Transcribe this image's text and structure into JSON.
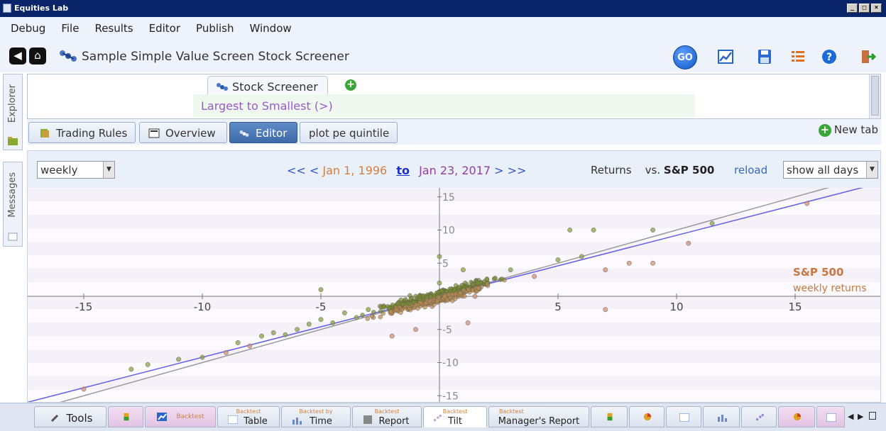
{
  "window": {
    "title": "Equities Lab"
  },
  "menu": [
    "Debug",
    "File",
    "Results",
    "Editor",
    "Publish",
    "Window"
  ],
  "toolbar": {
    "doc_title": "Sample Simple Value Screen Stock Screener",
    "go_label": "GO"
  },
  "side_tabs": {
    "explorer": "Explorer",
    "messages": "Messages"
  },
  "editor": {
    "screener_tab": "Stock Screener",
    "rank_text": "Largest to Smallest (>)"
  },
  "view_tabs": [
    "Trading Rules",
    "Overview",
    "Editor",
    "plot pe quintile"
  ],
  "new_tab_label": "New tab",
  "controls": {
    "frequency": "weekly",
    "range_prev": "<< <",
    "start_date": "Jan 1, 1996",
    "to_label": "to",
    "end_date": "Jan 23, 2017",
    "range_next": "> >>",
    "returns_label": "Returns",
    "vs_label": "vs.",
    "benchmark": "S&P 500",
    "reload_label": "reload",
    "days_option": "show all days"
  },
  "bottom_tabs": [
    {
      "top": "",
      "label": "Tools"
    },
    {
      "top": "",
      "label": ""
    },
    {
      "top": "",
      "label": "Backtest"
    },
    {
      "top": "Backtest",
      "label": "Table"
    },
    {
      "top": "Backtest by",
      "label": "Time"
    },
    {
      "top": "Backtest",
      "label": "Report"
    },
    {
      "top": "Backtest",
      "label": "Tilt"
    },
    {
      "top": "Backtest",
      "label": "Manager's Report"
    }
  ],
  "colors": {
    "accent": "#3355cc",
    "scatter_point": "#8a8a30",
    "fit_line": "#6060e8",
    "diagonal": "#999999"
  },
  "chart_data": {
    "type": "scatter",
    "title": "",
    "xlabel": "",
    "ylabel": "",
    "annotation": [
      "S&P 500",
      "weekly returns"
    ],
    "xlim": [
      -17.5,
      18.5
    ],
    "ylim": [
      -16,
      17
    ],
    "x_ticks": [
      -15,
      -10,
      -5,
      5,
      10,
      15
    ],
    "y_ticks": [
      15,
      10,
      5,
      -5,
      -10,
      -15
    ],
    "fit_line": {
      "slope": 0.92,
      "intercept": 0
    },
    "reference_line": {
      "slope": 1,
      "intercept": 0
    },
    "points_sample": [
      [
        -15,
        -14
      ],
      [
        -13,
        -11
      ],
      [
        -12.3,
        -10.3
      ],
      [
        -11,
        -9.5
      ],
      [
        -10,
        -9.2
      ],
      [
        -9,
        -8.5
      ],
      [
        -8.5,
        -7
      ],
      [
        -8,
        -7.5
      ],
      [
        -7.5,
        -6
      ],
      [
        -7,
        -5.5
      ],
      [
        -6.5,
        -5.8
      ],
      [
        -6,
        -5
      ],
      [
        -5.5,
        -4.2
      ],
      [
        -5,
        -3.5
      ],
      [
        -5,
        1
      ],
      [
        -4.5,
        -4
      ],
      [
        -4,
        -2.5
      ],
      [
        -3.5,
        -3.2
      ],
      [
        -3,
        -2
      ],
      [
        -2.5,
        -1.5
      ],
      [
        -2,
        -2.5
      ],
      [
        -1.5,
        -1
      ],
      [
        -1,
        0
      ],
      [
        0,
        6
      ],
      [
        0,
        2
      ],
      [
        1,
        4
      ],
      [
        1.5,
        0
      ],
      [
        2,
        2.5
      ],
      [
        3,
        4
      ],
      [
        4,
        3
      ],
      [
        5,
        5.5
      ],
      [
        5.5,
        10
      ],
      [
        6,
        6
      ],
      [
        6.5,
        10
      ],
      [
        7,
        4
      ],
      [
        7,
        -2
      ],
      [
        8,
        5
      ],
      [
        9,
        10
      ],
      [
        9,
        5
      ],
      [
        10.5,
        8
      ],
      [
        11.5,
        11
      ],
      [
        15.5,
        14
      ],
      [
        -1,
        -5
      ],
      [
        1.2,
        -4
      ],
      [
        -2,
        -6
      ]
    ]
  }
}
